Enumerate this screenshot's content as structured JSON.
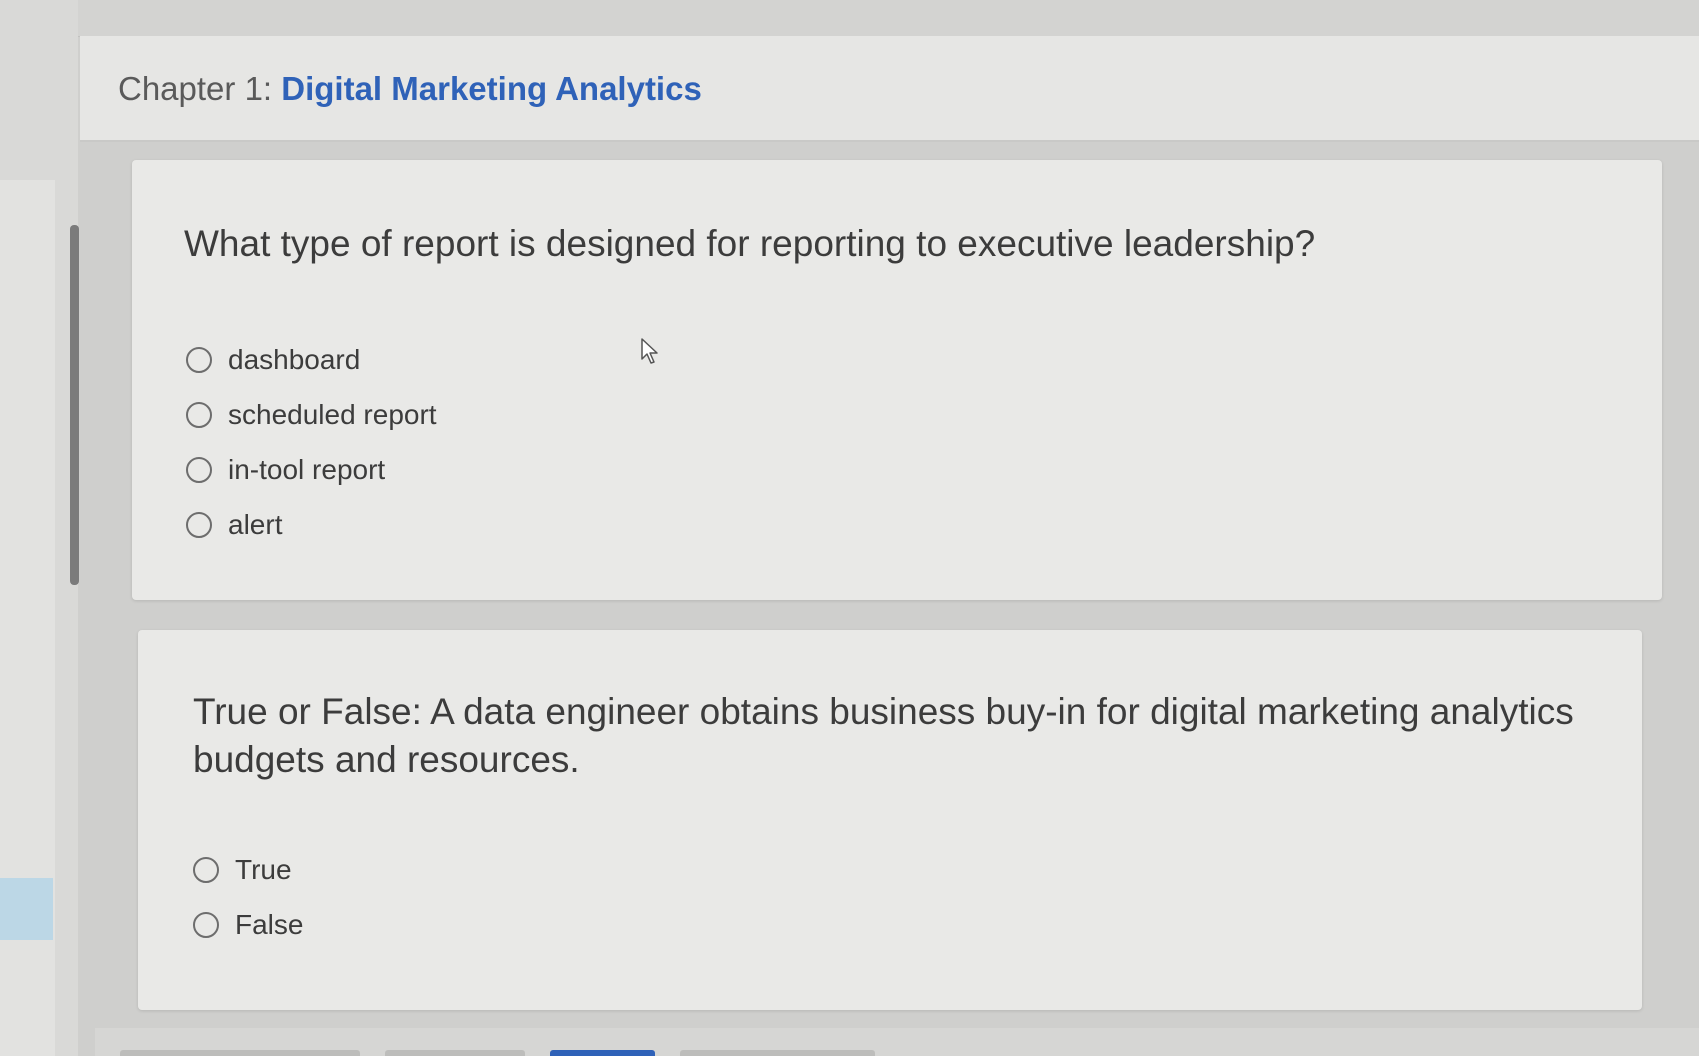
{
  "header": {
    "chapter_prefix": "Chapter 1: ",
    "chapter_title": "Digital Marketing Analytics"
  },
  "questions": [
    {
      "text": "What type of report is designed for reporting to executive leadership?",
      "options": [
        "dashboard",
        "scheduled report",
        "in-tool report",
        "alert"
      ]
    },
    {
      "text": "True or False: A data engineer obtains business buy-in for digital marketing analytics budgets and resources.",
      "options": [
        "True",
        "False"
      ]
    }
  ],
  "colors": {
    "accent": "#2f62b8",
    "card_background": "#e9e9e7",
    "page_background": "#cfcfcd"
  },
  "icons": {
    "cursor": "mouse-pointer-icon",
    "radio": "radio-unchecked-icon"
  }
}
